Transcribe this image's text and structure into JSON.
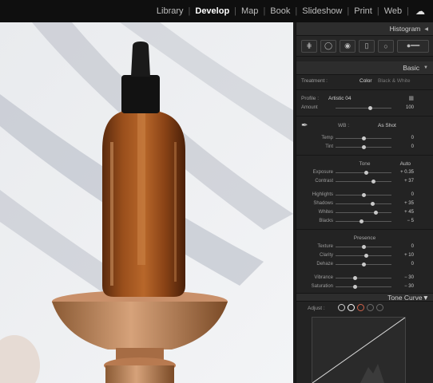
{
  "modules": [
    "Library",
    "Develop",
    "Map",
    "Book",
    "Slideshow",
    "Print",
    "Web"
  ],
  "active_module": "Develop",
  "panel": {
    "histogram_title": "Histogram",
    "basic_title": "Basic",
    "treatment_label": "Treatment :",
    "treatment_color": "Color",
    "treatment_bw": "Black & White",
    "profile_label": "Profile :",
    "profile_value": "Artistic 04",
    "amount_label": "Amount",
    "amount_value": "100",
    "amount_level": 0.62,
    "wb_label": "WB :",
    "wb_value": "As Shot",
    "tone_title": "Tone",
    "tone_auto": "Auto",
    "presence_title": "Presence",
    "tone_curve_title": "Tone Curve",
    "adjust_label": "Adjust :"
  },
  "sliders": {
    "temp": {
      "label": "Temp",
      "value": "0",
      "level": 0.5
    },
    "tint": {
      "label": "Tint",
      "value": "0",
      "level": 0.5
    },
    "exposure": {
      "label": "Exposure",
      "value": "+ 0.35",
      "level": 0.55
    },
    "contrast": {
      "label": "Contrast",
      "value": "+ 37",
      "level": 0.68
    },
    "highlights": {
      "label": "Highlights",
      "value": "0",
      "level": 0.5
    },
    "shadows": {
      "label": "Shadows",
      "value": "+ 35",
      "level": 0.67
    },
    "whites": {
      "label": "Whites",
      "value": "+ 45",
      "level": 0.72
    },
    "blacks": {
      "label": "Blacks",
      "value": "− 5",
      "level": 0.47
    },
    "texture": {
      "label": "Texture",
      "value": "0",
      "level": 0.5
    },
    "clarity": {
      "label": "Clarity",
      "value": "+ 10",
      "level": 0.55
    },
    "dehaze": {
      "label": "Dehaze",
      "value": "0",
      "level": 0.5
    },
    "vibrance": {
      "label": "Vibrance",
      "value": "− 30",
      "level": 0.35
    },
    "saturation": {
      "label": "Saturation",
      "value": "− 30",
      "level": 0.35
    }
  },
  "icons": {
    "cloud": "cloud-sync-icon",
    "dropper": "eyedropper-icon",
    "grid": "profile-browser-icon"
  }
}
